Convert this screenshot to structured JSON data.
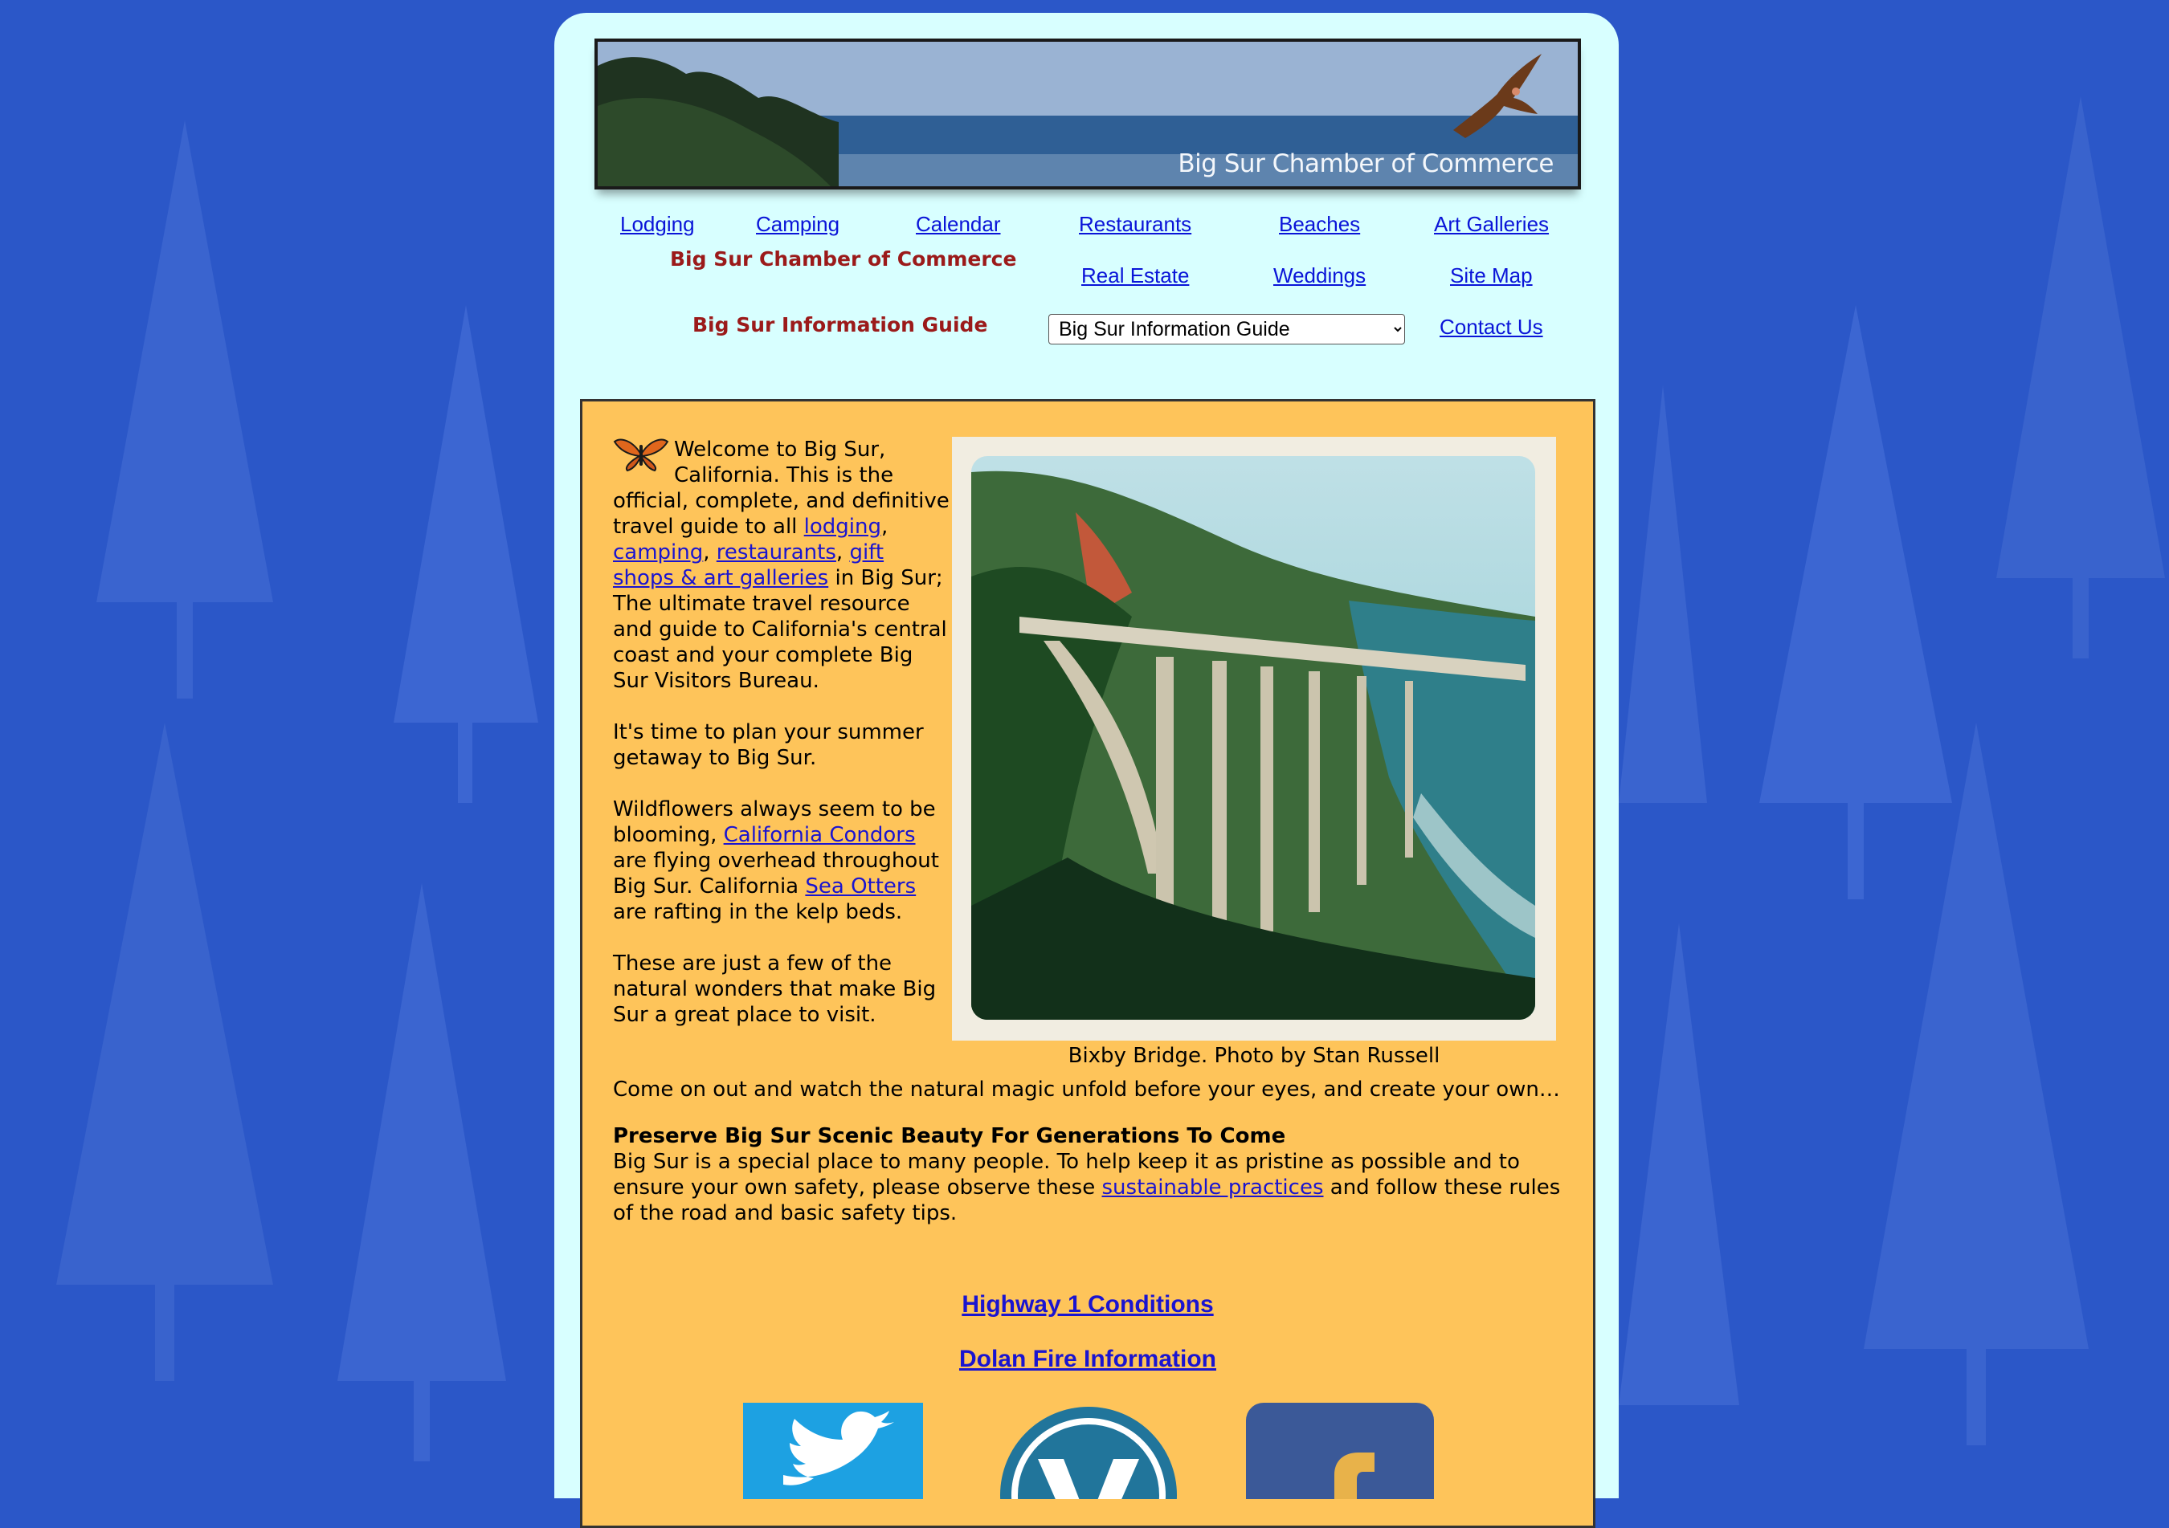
{
  "banner": {
    "title": "Big Sur Chamber of Commerce"
  },
  "nav": {
    "lodging": "Lodging",
    "camping": "Camping",
    "calendar": "Calendar",
    "restaurants": "Restaurants",
    "beaches": "Beaches",
    "art_galleries": "Art Galleries",
    "real_estate": "Real Estate",
    "weddings": "Weddings",
    "site_map": "Site Map",
    "contact_us": "Contact Us"
  },
  "brand": {
    "chamber": "Big Sur Chamber of Commerce",
    "guide": "Big Sur Information Guide"
  },
  "guide_select": {
    "selected": "Big Sur Information Guide"
  },
  "intro": {
    "p1_a": "Welcome to Big Sur, California. This is the official, complete, and definitive travel guide to all ",
    "link_lodging": "lodging",
    "sep1": ", ",
    "link_camping": "camping",
    "sep2": ", ",
    "link_restaurants": "restaurants",
    "sep3": ", ",
    "link_gifts": "gift shops & art galleries",
    "p1_b": " in Big Sur; The ultimate travel resource and guide to California's central coast and your complete Big Sur Visitors Bureau.",
    "p2": "It's time to plan your summer getaway to Big Sur.",
    "p3_a": "Wildflowers always seem to be blooming, ",
    "link_condors": "California Condors",
    "p3_b": " are flying overhead throughout Big Sur. California ",
    "link_otters": "Sea Otters",
    "p3_c": " are rafting in the kelp beds.",
    "p4_a": "These are just a few of the natural wonders that make Big Sur a great place to visit.",
    "p4_b": "Come on out and watch the natural magic unfold before your eyes, and create your own…"
  },
  "photo": {
    "caption": "Bixby Bridge. Photo by Stan Russell"
  },
  "preserve": {
    "heading": "Preserve Big Sur Scenic Beauty For Generations To Come",
    "text_a": "Big Sur is a special place to many people. To help keep it as pristine as possible and to ensure your own safety, please observe these ",
    "link_practices": "sustainable practices",
    "text_b": " and follow these rules of the road and basic safety tips."
  },
  "links": {
    "highway": "Highway 1 Conditions",
    "dolan": "Dolan Fire Information"
  },
  "social": {
    "twitter_icon": "twitter-icon",
    "wordpress_icon": "wordpress-icon",
    "facebook_icon": "facebook-icon",
    "twitter_color": "#1da1e2",
    "facebook_color": "#3b5998",
    "wordpress_color": "#21759b"
  },
  "colors": {
    "background": "#2b57c8",
    "page": "#d8ffff",
    "content": "#fec45a",
    "brand_red": "#9b1a1a",
    "link": "#0a14d8"
  }
}
